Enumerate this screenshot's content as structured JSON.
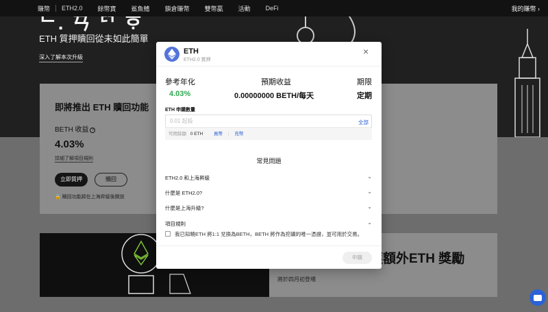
{
  "nav": {
    "items": [
      "賺幣",
      "ETH2.0",
      "餘幣寶",
      "鯊魚鰭",
      "鎖倉賺幣",
      "雙幣贏",
      "活動",
      "DeFi"
    ],
    "my_earnings": "我的賺幣 ›"
  },
  "hero": {
    "title_fragment": "ᄂ. ㄢ ᄗ ᄒᆞ",
    "tagline": "ETH 質押贖回從未如此簡單",
    "learn_more": "深入了解本次升級"
  },
  "card": {
    "title": "即將推出 ETH 贖回功能",
    "beth_label": "BETH 收益",
    "rate": "4.03%",
    "rules_link": "詳細了解項目規則",
    "stake_button": "立即質押",
    "redeem_button": "贖回",
    "note": "贖回功能將在上海昇級後開放"
  },
  "banner": {
    "title": "獲額外ETH 獎勵",
    "subtitle": "將於四月初登場"
  },
  "modal": {
    "title": "ETH",
    "subtitle": "ETH2.0 質押",
    "close": "×",
    "apr_label": "參考年化",
    "apr_value": "4.03%",
    "expected_label": "預期收益",
    "expected_value": "0.00000000 BETH/每天",
    "term_label": "期限",
    "term_value": "定期",
    "amount_label": "ETH 申購數量",
    "amount_placeholder": "0.01 起投",
    "all_label": "全部",
    "avail_label": "可用餘額",
    "avail_value": "0 ETH",
    "buy_link": "買幣",
    "deposit_link": "充幣",
    "faq_title": "常見問題",
    "faq": [
      "ETH2.0 和上海昇級",
      "什麼是 ETH2.0?",
      "什麼是上海升級?",
      "項目規則"
    ],
    "agree_text": "我已知曉ETH 將1:1 兌換為BETH，BETH 將作為挖礦的唯一憑證，並可用於交易。",
    "apply_button": "申購"
  },
  "colors": {
    "accent_green": "#2fa84f",
    "link_blue": "#2b62d6",
    "eth_logo": "#5474d9"
  }
}
